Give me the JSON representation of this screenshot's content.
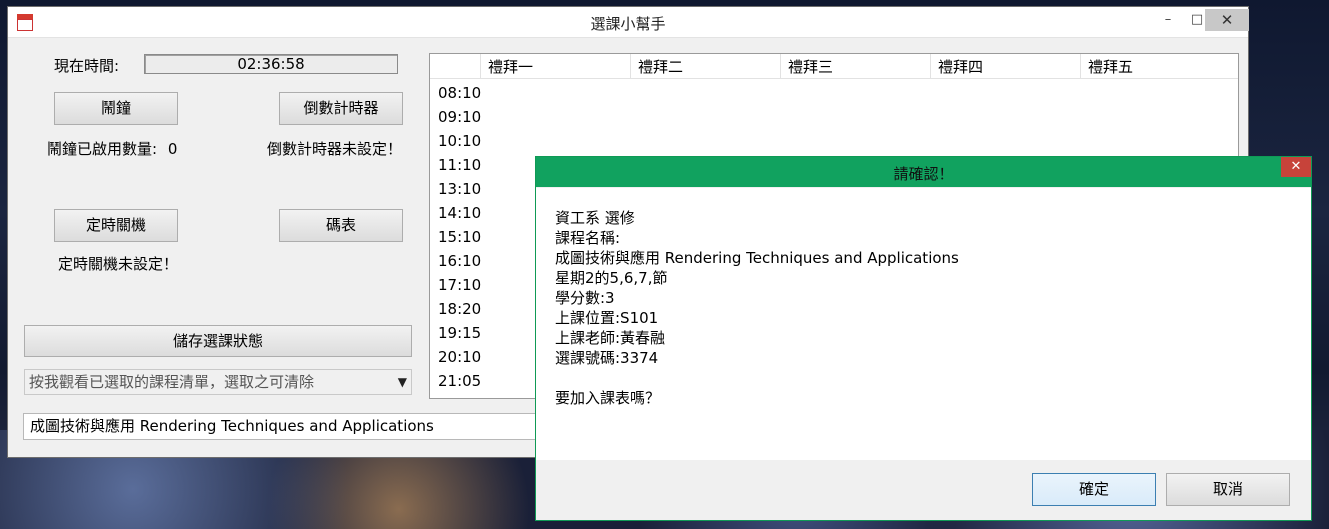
{
  "window": {
    "title": "選課小幫手",
    "controls": {
      "minimize": "–",
      "maximize": "□",
      "close": "✕"
    }
  },
  "left_panel": {
    "current_time_label": "現在時間:",
    "current_time_value": "02:36:58",
    "alarm_button": "鬧鐘",
    "countdown_button": "倒數計時器",
    "alarm_count_label": "鬧鐘已啟用數量:",
    "alarm_count_value": "0",
    "countdown_status": "倒數計時器未設定！",
    "shutdown_button": "定時關機",
    "stopwatch_button": "碼表",
    "shutdown_status": "定時關機未設定！",
    "save_button": "儲存選課狀態",
    "selected_combo_text": "按我觀看已選取的課程清單，選取之可清除",
    "course_field_value": "成圖技術與應用  Rendering Techniques and Applications"
  },
  "timetable": {
    "days": [
      "禮拜一",
      "禮拜二",
      "禮拜三",
      "禮拜四",
      "禮拜五"
    ],
    "times": [
      "08:10",
      "09:10",
      "10:10",
      "11:10",
      "13:10",
      "14:10",
      "15:10",
      "16:10",
      "17:10",
      "18:20",
      "19:15",
      "20:10",
      "21:05"
    ]
  },
  "dialog": {
    "title": "請確認！",
    "close": "✕",
    "lines": [
      "資工系 選修",
      "課程名稱:",
      "成圖技術與應用  Rendering Techniques and Applications",
      "星期2的5,6,7,節",
      "學分數:3",
      "上課位置:S101",
      "上課老師:黃春融",
      "選課號碼:3374",
      "",
      "要加入課表嗎？"
    ],
    "ok_button": "確定",
    "cancel_button": "取消"
  }
}
